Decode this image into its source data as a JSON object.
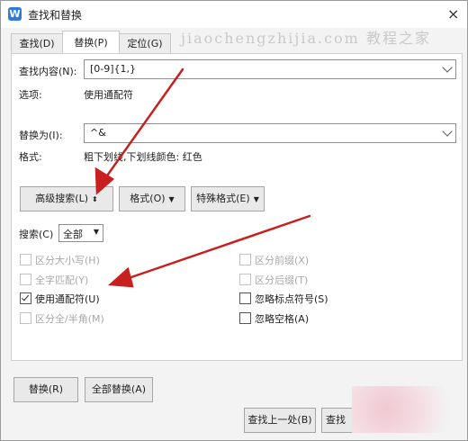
{
  "window": {
    "title": "查找和替换",
    "app_icon": "W",
    "close": "×"
  },
  "watermark": "jiaochengzhijia.com 教程之家",
  "tabs": [
    {
      "label": "查找(D)",
      "active": false
    },
    {
      "label": "替换(P)",
      "active": true
    },
    {
      "label": "定位(G)",
      "active": false
    }
  ],
  "find": {
    "label": "查找内容(N):",
    "value": "[0-9]{1,}"
  },
  "options": {
    "label": "选项:",
    "value": "使用通配符"
  },
  "replace": {
    "label": "替换为(I):",
    "value": "^&"
  },
  "format": {
    "label": "格式:",
    "value": "粗下划线,下划线颜色: 红色"
  },
  "buttons": {
    "advanced": "高级搜索(L)",
    "advanced_icon": "⬍",
    "format": "格式(O)",
    "special": "特殊格式(E)",
    "replace": "替换(R)",
    "replace_all": "全部替换(A)",
    "find_prev": "查找上一处(B)",
    "find_next": "查找"
  },
  "search": {
    "label": "搜索(C)",
    "value": "全部"
  },
  "checkboxes_left": [
    {
      "label": "区分大小写(H)",
      "checked": false,
      "disabled": true
    },
    {
      "label": "全字匹配(Y)",
      "checked": false,
      "disabled": true
    },
    {
      "label": "使用通配符(U)",
      "checked": true,
      "disabled": false
    },
    {
      "label": "区分全/半角(M)",
      "checked": false,
      "disabled": true
    }
  ],
  "checkboxes_right": [
    {
      "label": "区分前缀(X)",
      "checked": false,
      "disabled": true
    },
    {
      "label": "区分后缀(T)",
      "checked": false,
      "disabled": true
    },
    {
      "label": "忽略标点符号(S)",
      "checked": false,
      "disabled": false
    },
    {
      "label": "忽略空格(A)",
      "checked": false,
      "disabled": false
    }
  ],
  "colors": {
    "annotation_arrow": "#c8201e",
    "accent": "#2f7be0"
  }
}
